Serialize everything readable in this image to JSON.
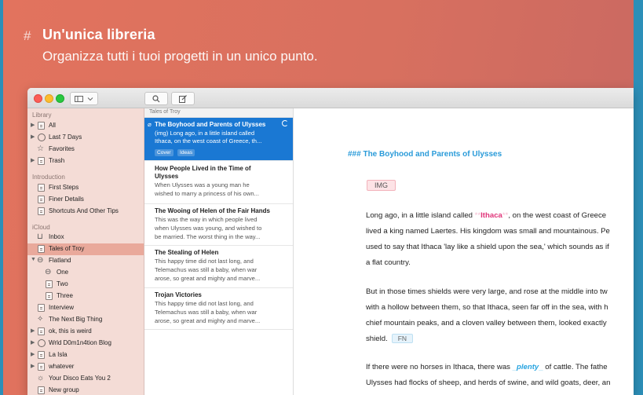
{
  "header": {
    "hash": "#",
    "title": "Un'unica libreria",
    "subtitle": "Organizza tutti i tuoi progetti in un unico punto."
  },
  "toolbar": {
    "sidebar_toggle_icon": "sidebar-icon",
    "search_icon": "magnifier-icon",
    "compose_icon": "compose-icon"
  },
  "sidebar": {
    "sections": {
      "library": "Library",
      "introduction": "Introduction",
      "icloud": "iCloud"
    },
    "library_items": [
      {
        "label": "All",
        "icon": "document-icon"
      },
      {
        "label": "Last 7 Days",
        "icon": "clock-icon"
      },
      {
        "label": "Favorites",
        "icon": "star-icon"
      },
      {
        "label": "Trash",
        "icon": "trash-icon"
      }
    ],
    "introduction_items": [
      {
        "label": "First Steps"
      },
      {
        "label": "Finer Details"
      },
      {
        "label": "Shortcuts And Other Tips"
      }
    ],
    "icloud_items": [
      {
        "label": "Inbox"
      },
      {
        "label": "Tales of Troy"
      },
      {
        "label": "Flatland"
      },
      {
        "label": "One"
      },
      {
        "label": "Two"
      },
      {
        "label": "Three"
      },
      {
        "label": "Interview"
      },
      {
        "label": "The Next Big Thing"
      },
      {
        "label": "ok, this is weird"
      },
      {
        "label": "Wrld D0m1n4tion Blog"
      },
      {
        "label": "La Isla"
      },
      {
        "label": "whatever"
      },
      {
        "label": "Your Disco Eats You 2"
      },
      {
        "label": "New group"
      }
    ]
  },
  "notes": {
    "group_title": "Tales of Troy",
    "items": [
      {
        "title": "The Boyhood and Parents of Ulysses",
        "lines": [
          "(img) Long ago, in a little island called",
          "Ithaca, on the west coast of Greece, th..."
        ],
        "tags": [
          "Cover",
          "Ideas"
        ]
      },
      {
        "title_lines": [
          "How People Lived in the Time of",
          "Ulysses"
        ],
        "lines": [
          "When Ulysses was a young man he",
          "wished to marry a princess of his own..."
        ]
      },
      {
        "title": "The Wooing of Helen of the Fair Hands",
        "lines": [
          "This was the way in which people lived",
          "when Ulysses was young, and wished to",
          "be married. The worst thing in the way..."
        ]
      },
      {
        "title": "The Stealing of Helen",
        "lines": [
          "This happy time did not last long, and",
          "Telemachus was still a baby, when war",
          "arose, so great and mighty and marve..."
        ]
      },
      {
        "title": "Trojan Victories",
        "lines": [
          "This happy time did not last long, and",
          "Telemachus was still a baby, when war",
          "arose, so great and mighty and marve..."
        ]
      }
    ]
  },
  "editor": {
    "heading": "### The Boyhood and Parents of Ulysses",
    "img_tag": "IMG",
    "p1": {
      "l1_pre": "Long ago, in a little island called ",
      "l1_mark_open": "**",
      "l1_bold": "Ithaca",
      "l1_mark_close": "**",
      "l1_post": ", on the west coast of Greece",
      "l2": "lived a king named Laertes. His kingdom was small and mountainous. Pe",
      "l3": "used to say that Ithaca 'lay like a shield upon the sea,' which sounds as if",
      "l4": "a flat country."
    },
    "p2": {
      "l1": "But in those times shields were very large, and rose at the middle into tw",
      "l2": "with a hollow between them, so that Ithaca, seen far off in the sea, with h",
      "l3": "chief mountain peaks, and a cloven valley between them, looked exactly",
      "l4": "shield.",
      "fn_tag": "FN"
    },
    "p3": {
      "l1_pre": "If there were no horses in Ithaca, there was ",
      "l1_mark_open": "_",
      "l1_italic": "plenty",
      "l1_mark_close": "_",
      "l1_post": " of cattle. The fathe",
      "l2": "Ulysses had flocks of sheep, and herds of swine, and wild goats, deer, an"
    }
  },
  "colors": {
    "background": "#e2735e",
    "sidebar_bg": "#f4dcd6",
    "selected_sidebar": "#e9a99b",
    "selected_note": "#1a78d3",
    "heading_blue": "#2a9bd9",
    "bold_pink": "#e0357a"
  }
}
